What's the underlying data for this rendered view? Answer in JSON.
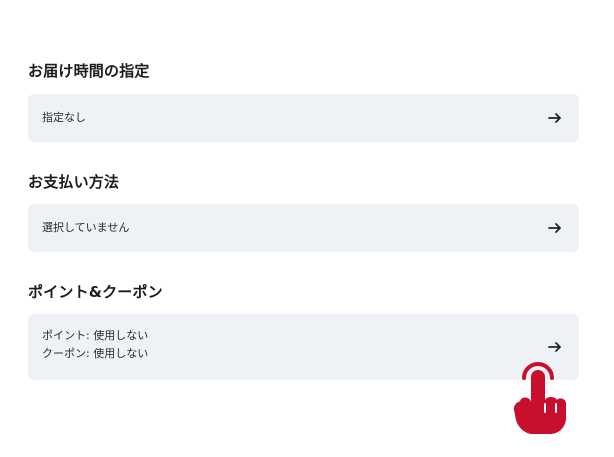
{
  "delivery_time": {
    "heading": "お届け時間の指定",
    "value": "指定なし"
  },
  "payment": {
    "heading": "お支払い方法",
    "value": "選択していません"
  },
  "points_coupons": {
    "heading": "ポイント&クーポン",
    "points_line": "ポイント: 使用しない",
    "coupons_line": "クーポン: 使用しない"
  },
  "colors": {
    "row_bg": "#eef1f5",
    "hand": "#c8102e"
  },
  "icons": {
    "arrow": "arrow-right-icon",
    "pointer": "tap-hand-icon"
  }
}
